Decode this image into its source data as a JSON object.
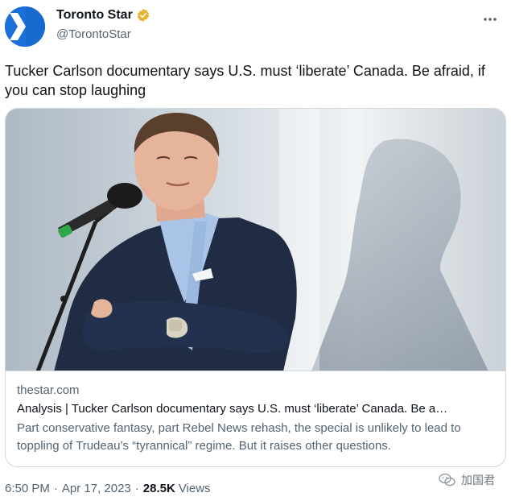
{
  "account": {
    "display_name": "Toronto Star",
    "handle": "@TorontoStar",
    "avatar_icon": "toronto-star-chevron-logo",
    "verified_color": "#e8b32a"
  },
  "tweet": {
    "text": "Tucker Carlson documentary says U.S. must ‘liberate’ Canada. Be afraid, if you can stop laughing"
  },
  "card": {
    "image_alt": "tucker-carlson-photo",
    "domain": "thestar.com",
    "title": "Analysis | Tucker Carlson documentary says U.S. must ‘liberate’ Canada. Be a…",
    "description": "Part conservative fantasy, part Rebel News rehash, the special is unlikely to lead to toppling of Trudeau’s “tyrannical” regime. But it raises other questions."
  },
  "meta": {
    "time": "6:50 PM",
    "separator": "·",
    "date": "Apr 17, 2023",
    "views_count": "28.5K",
    "views_label": "Views"
  },
  "watermark": {
    "text": "加国君"
  },
  "colors": {
    "brand_blue": "#1a6fd8",
    "text_secondary": "#536471",
    "border": "#cfd9de"
  }
}
